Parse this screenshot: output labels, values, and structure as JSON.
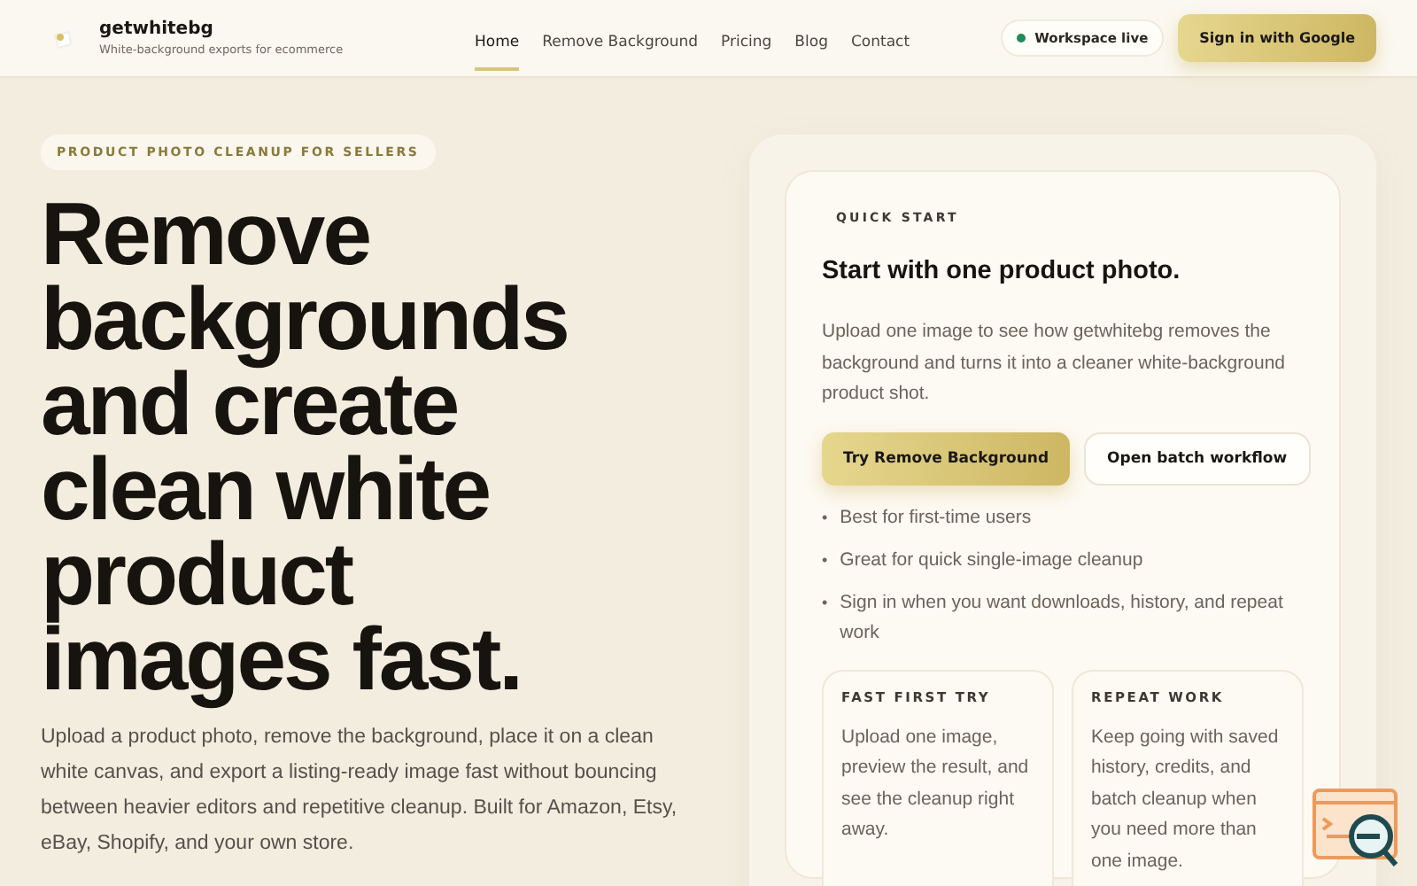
{
  "header": {
    "brand": "getwhitebg",
    "tagline": "White-background exports for ecommerce",
    "nav": [
      {
        "label": "Home",
        "selected": true
      },
      {
        "label": "Remove Background",
        "selected": false
      },
      {
        "label": "Pricing",
        "selected": false
      },
      {
        "label": "Blog",
        "selected": false
      },
      {
        "label": "Contact",
        "selected": false
      }
    ],
    "status": {
      "label": "Workspace live",
      "color": "#1f8a5b"
    },
    "sign_in": "Sign in with Google"
  },
  "hero": {
    "eyebrow": "PRODUCT PHOTO CLEANUP FOR SELLERS",
    "headline": "Remove backgrounds and create clean white product images fast.",
    "body": "Upload a product photo, remove the background, place it on a clean white canvas, and export a listing-ready image fast without bouncing between heavier editors and repetitive cleanup. Built for Amazon, Etsy, eBay, Shopify, and your own store."
  },
  "quick_start": {
    "eyebrow": "QUICK START",
    "title": "Start with one product photo.",
    "body": "Upload one image to see how getwhitebg removes the background and turns it into a cleaner white-background product shot.",
    "buttons": [
      {
        "label": "Try Remove Background",
        "kind": "primary"
      },
      {
        "label": "Open batch workflow",
        "kind": "secondary"
      }
    ],
    "bullets": [
      {
        "marker": "•",
        "text": "Best for first-time users"
      },
      {
        "marker": "•",
        "text": "Great for quick single-image cleanup"
      },
      {
        "marker": "•",
        "text": "Sign in when you want downloads, history, and repeat work"
      }
    ],
    "cards": [
      {
        "title": "FAST FIRST TRY",
        "body": "Upload one image, preview the result, and see the cleanup right away."
      },
      {
        "title": "REPEAT WORK",
        "body": "Keep going with saved history, credits, and batch cleanup when you need more than one image."
      }
    ]
  }
}
